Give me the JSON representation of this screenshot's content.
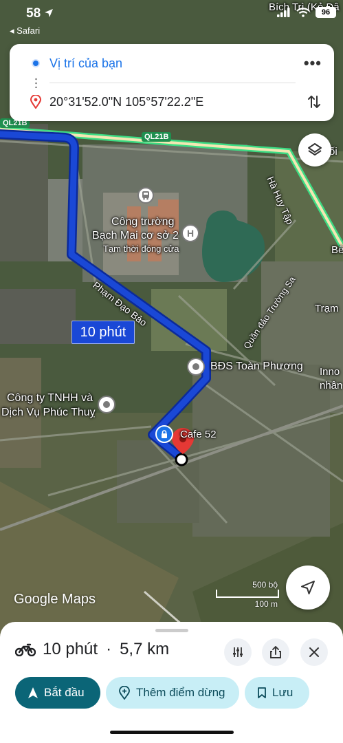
{
  "status_bar": {
    "time": "58",
    "back_label": "◂ Safari",
    "battery": "96"
  },
  "route": {
    "origin": "Vị trí của bạn",
    "destination": "20°31'52.0\"N 105°57'22.2\"E"
  },
  "map": {
    "labels": {
      "top_right": "Bích Trì (Kẻ Đâ",
      "thoi": "ối",
      "ha_huy_tap": "Hà Huy Tập",
      "be": "Bê",
      "tram": "Trạm",
      "inno": "Inno",
      "nhan": "nhân",
      "cong_truong_1": "Công trường",
      "cong_truong_2": "Bạch Mai cơ sở 2",
      "tam_thoi": "Tạm thời đóng cửa",
      "pham_dao_bao": "Phạm Đạo Bảo",
      "quan_dao": "Quần đảo Trường Sa",
      "bds": "BĐS Toàn Phương",
      "cong_ty_1": "Công ty TNHH và",
      "cong_ty_2": "Dịch Vụ Phúc Thuỵ",
      "cafe": "Cafe 52"
    },
    "shields": {
      "ql21b_left": "QL21B",
      "ql21b": "QL21B"
    },
    "eta_chip": "10 phút",
    "logo": "Google Maps",
    "scale_top": "500 bộ",
    "scale_bottom": "100 m",
    "colors": {
      "route": "#1a48d6",
      "highway": "#3ddc84",
      "destination": "#e53935"
    }
  },
  "sheet": {
    "duration": "10 phút",
    "separator": "·",
    "distance": "5,7 km",
    "buttons": {
      "start": "Bắt đầu",
      "add_stop": "Thêm điểm dừng",
      "save": "Lưu"
    }
  }
}
